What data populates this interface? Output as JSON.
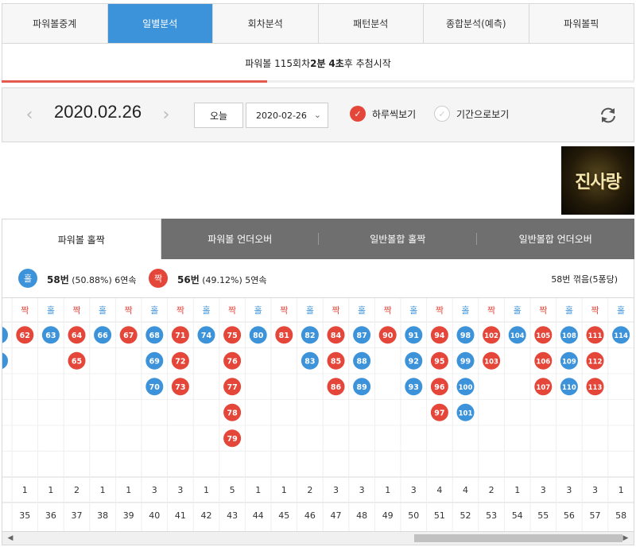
{
  "nav": {
    "tabs": [
      "파워볼중계",
      "일별분석",
      "회차분석",
      "패턴분석",
      "종합분석(예측)",
      "파워볼픽"
    ],
    "active_index": 1
  },
  "status": {
    "prefix": "파워볼 115회차 ",
    "minutes": "2분",
    "seconds": "4초",
    "suffix": "후 추첨시작",
    "progress_fraction": 0.42
  },
  "datebar": {
    "prev_icon": "chevron-left-icon",
    "next_icon": "chevron-right-icon",
    "date": "2020.02.26",
    "today_label": "오늘",
    "select_value": "2020-02-26",
    "daily_label": "하루씩보기",
    "period_label": "기간으로보기",
    "refresh_icon": "refresh-icon"
  },
  "ad": {
    "text": "진사랑"
  },
  "analysis_tabs": [
    "파워볼 홀짝",
    "파워볼 언더오버",
    "일반볼합 홀짝",
    "일반볼합 언더오버"
  ],
  "summary": {
    "odd_badge": "홀",
    "odd_count": "58번",
    "odd_detail": "(50.88%) 6연속",
    "even_badge": "짝",
    "even_count": "56번",
    "even_detail": "(49.12%) 5연속",
    "right_text": "58번 꺾음(5퐁당)"
  },
  "colors": {
    "odd": "#3d93d9",
    "even": "#e5463a",
    "nav_active": "#3d93d9"
  },
  "grid": {
    "header_labels": {
      "odd": "홀",
      "even": "짝"
    },
    "columns": [
      {
        "type": "even",
        "balls": [
          62
        ],
        "count": 1,
        "number": 35
      },
      {
        "type": "odd",
        "balls": [
          63
        ],
        "count": 1,
        "number": 36
      },
      {
        "type": "even",
        "balls": [
          64,
          65
        ],
        "count": 2,
        "number": 37
      },
      {
        "type": "odd",
        "balls": [
          66
        ],
        "count": 1,
        "number": 38
      },
      {
        "type": "even",
        "balls": [
          67
        ],
        "count": 1,
        "number": 39
      },
      {
        "type": "odd",
        "balls": [
          68,
          69,
          70
        ],
        "count": 3,
        "number": 40
      },
      {
        "type": "even",
        "balls": [
          71,
          72,
          73
        ],
        "count": 3,
        "number": 41
      },
      {
        "type": "odd",
        "balls": [
          74
        ],
        "count": 1,
        "number": 42
      },
      {
        "type": "even",
        "balls": [
          75,
          76,
          77,
          78,
          79
        ],
        "count": 5,
        "number": 43
      },
      {
        "type": "odd",
        "balls": [
          80
        ],
        "count": 1,
        "number": 44
      },
      {
        "type": "even",
        "balls": [
          81
        ],
        "count": 1,
        "number": 45
      },
      {
        "type": "odd",
        "balls": [
          82,
          83
        ],
        "count": 2,
        "number": 46
      },
      {
        "type": "even",
        "balls": [
          84,
          85,
          86
        ],
        "count": 3,
        "number": 47
      },
      {
        "type": "odd",
        "balls": [
          87,
          88,
          89
        ],
        "count": 3,
        "number": 48
      },
      {
        "type": "even",
        "balls": [
          90
        ],
        "count": 1,
        "number": 49
      },
      {
        "type": "odd",
        "balls": [
          91,
          92,
          93
        ],
        "count": 3,
        "number": 50
      },
      {
        "type": "even",
        "balls": [
          94,
          95,
          96,
          97
        ],
        "count": 4,
        "number": 51
      },
      {
        "type": "odd",
        "balls": [
          98,
          99,
          100,
          101
        ],
        "count": 4,
        "number": 52
      },
      {
        "type": "even",
        "balls": [
          102,
          103
        ],
        "count": 2,
        "number": 53
      },
      {
        "type": "odd",
        "balls": [
          104
        ],
        "count": 1,
        "number": 54
      },
      {
        "type": "even",
        "balls": [
          105,
          106,
          107
        ],
        "count": 3,
        "number": 55
      },
      {
        "type": "odd",
        "balls": [
          108,
          109,
          110
        ],
        "count": 3,
        "number": 56
      },
      {
        "type": "even",
        "balls": [
          111,
          112,
          113
        ],
        "count": 3,
        "number": 57
      },
      {
        "type": "odd",
        "balls": [
          114
        ],
        "count": 1,
        "number": 58
      }
    ]
  },
  "scroll": {
    "left_icon": "arrow-left-icon",
    "right_icon": "arrow-right-icon"
  }
}
